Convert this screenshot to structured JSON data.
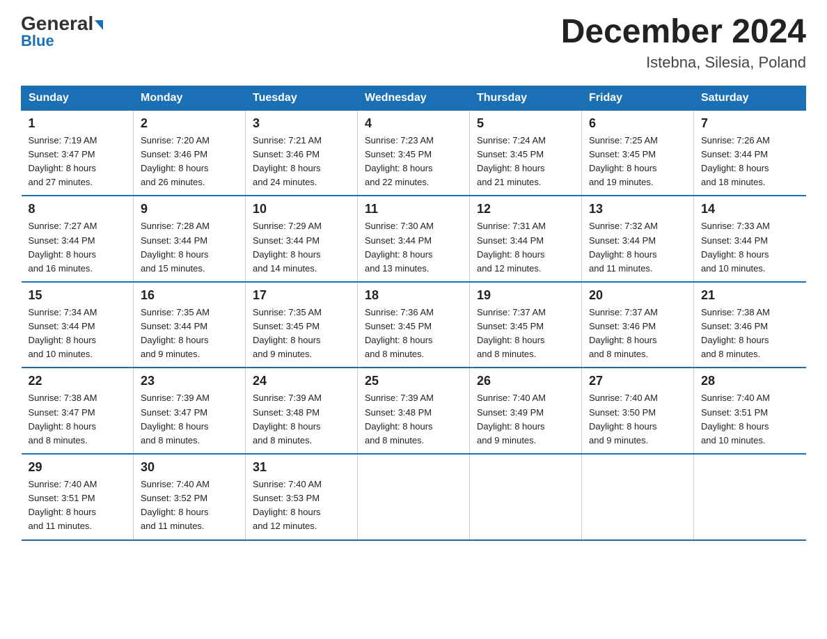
{
  "header": {
    "logo_general": "General",
    "logo_blue": "Blue",
    "month_year": "December 2024",
    "location": "Istebna, Silesia, Poland"
  },
  "days_of_week": [
    "Sunday",
    "Monday",
    "Tuesday",
    "Wednesday",
    "Thursday",
    "Friday",
    "Saturday"
  ],
  "weeks": [
    [
      {
        "day": "1",
        "sunrise": "7:19 AM",
        "sunset": "3:47 PM",
        "daylight": "8 hours and 27 minutes."
      },
      {
        "day": "2",
        "sunrise": "7:20 AM",
        "sunset": "3:46 PM",
        "daylight": "8 hours and 26 minutes."
      },
      {
        "day": "3",
        "sunrise": "7:21 AM",
        "sunset": "3:46 PM",
        "daylight": "8 hours and 24 minutes."
      },
      {
        "day": "4",
        "sunrise": "7:23 AM",
        "sunset": "3:45 PM",
        "daylight": "8 hours and 22 minutes."
      },
      {
        "day": "5",
        "sunrise": "7:24 AM",
        "sunset": "3:45 PM",
        "daylight": "8 hours and 21 minutes."
      },
      {
        "day": "6",
        "sunrise": "7:25 AM",
        "sunset": "3:45 PM",
        "daylight": "8 hours and 19 minutes."
      },
      {
        "day": "7",
        "sunrise": "7:26 AM",
        "sunset": "3:44 PM",
        "daylight": "8 hours and 18 minutes."
      }
    ],
    [
      {
        "day": "8",
        "sunrise": "7:27 AM",
        "sunset": "3:44 PM",
        "daylight": "8 hours and 16 minutes."
      },
      {
        "day": "9",
        "sunrise": "7:28 AM",
        "sunset": "3:44 PM",
        "daylight": "8 hours and 15 minutes."
      },
      {
        "day": "10",
        "sunrise": "7:29 AM",
        "sunset": "3:44 PM",
        "daylight": "8 hours and 14 minutes."
      },
      {
        "day": "11",
        "sunrise": "7:30 AM",
        "sunset": "3:44 PM",
        "daylight": "8 hours and 13 minutes."
      },
      {
        "day": "12",
        "sunrise": "7:31 AM",
        "sunset": "3:44 PM",
        "daylight": "8 hours and 12 minutes."
      },
      {
        "day": "13",
        "sunrise": "7:32 AM",
        "sunset": "3:44 PM",
        "daylight": "8 hours and 11 minutes."
      },
      {
        "day": "14",
        "sunrise": "7:33 AM",
        "sunset": "3:44 PM",
        "daylight": "8 hours and 10 minutes."
      }
    ],
    [
      {
        "day": "15",
        "sunrise": "7:34 AM",
        "sunset": "3:44 PM",
        "daylight": "8 hours and 10 minutes."
      },
      {
        "day": "16",
        "sunrise": "7:35 AM",
        "sunset": "3:44 PM",
        "daylight": "8 hours and 9 minutes."
      },
      {
        "day": "17",
        "sunrise": "7:35 AM",
        "sunset": "3:45 PM",
        "daylight": "8 hours and 9 minutes."
      },
      {
        "day": "18",
        "sunrise": "7:36 AM",
        "sunset": "3:45 PM",
        "daylight": "8 hours and 8 minutes."
      },
      {
        "day": "19",
        "sunrise": "7:37 AM",
        "sunset": "3:45 PM",
        "daylight": "8 hours and 8 minutes."
      },
      {
        "day": "20",
        "sunrise": "7:37 AM",
        "sunset": "3:46 PM",
        "daylight": "8 hours and 8 minutes."
      },
      {
        "day": "21",
        "sunrise": "7:38 AM",
        "sunset": "3:46 PM",
        "daylight": "8 hours and 8 minutes."
      }
    ],
    [
      {
        "day": "22",
        "sunrise": "7:38 AM",
        "sunset": "3:47 PM",
        "daylight": "8 hours and 8 minutes."
      },
      {
        "day": "23",
        "sunrise": "7:39 AM",
        "sunset": "3:47 PM",
        "daylight": "8 hours and 8 minutes."
      },
      {
        "day": "24",
        "sunrise": "7:39 AM",
        "sunset": "3:48 PM",
        "daylight": "8 hours and 8 minutes."
      },
      {
        "day": "25",
        "sunrise": "7:39 AM",
        "sunset": "3:48 PM",
        "daylight": "8 hours and 8 minutes."
      },
      {
        "day": "26",
        "sunrise": "7:40 AM",
        "sunset": "3:49 PM",
        "daylight": "8 hours and 9 minutes."
      },
      {
        "day": "27",
        "sunrise": "7:40 AM",
        "sunset": "3:50 PM",
        "daylight": "8 hours and 9 minutes."
      },
      {
        "day": "28",
        "sunrise": "7:40 AM",
        "sunset": "3:51 PM",
        "daylight": "8 hours and 10 minutes."
      }
    ],
    [
      {
        "day": "29",
        "sunrise": "7:40 AM",
        "sunset": "3:51 PM",
        "daylight": "8 hours and 11 minutes."
      },
      {
        "day": "30",
        "sunrise": "7:40 AM",
        "sunset": "3:52 PM",
        "daylight": "8 hours and 11 minutes."
      },
      {
        "day": "31",
        "sunrise": "7:40 AM",
        "sunset": "3:53 PM",
        "daylight": "8 hours and 12 minutes."
      },
      null,
      null,
      null,
      null
    ]
  ],
  "labels": {
    "sunrise": "Sunrise:",
    "sunset": "Sunset:",
    "daylight": "Daylight:"
  }
}
